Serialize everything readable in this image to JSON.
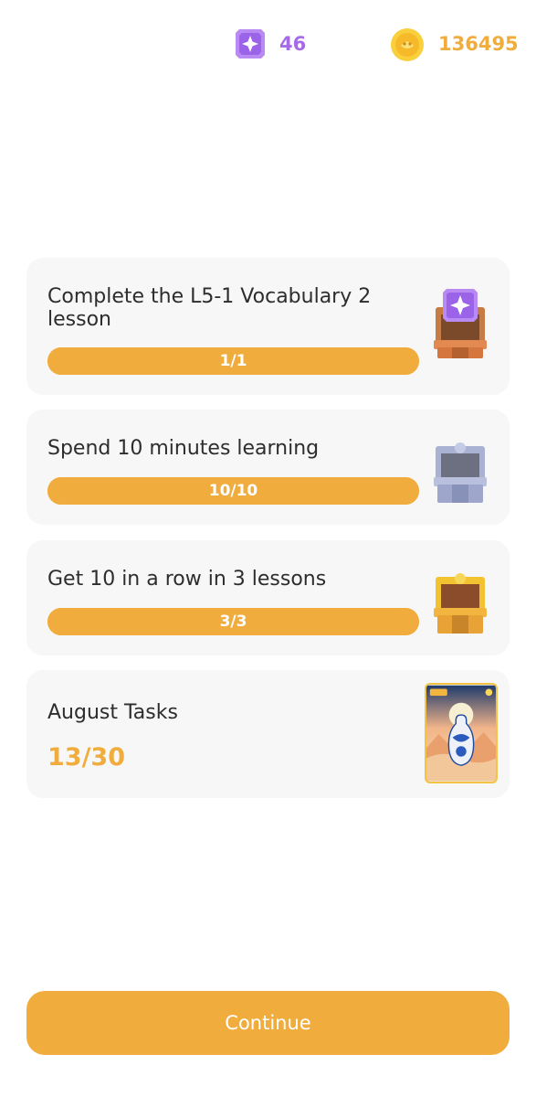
{
  "header": {
    "gem_icon": "purple-gem-icon",
    "gem_count": "46",
    "coin_icon": "gold-coin-icon",
    "coin_count": "136495",
    "gem_color": "#a66be6",
    "coin_color": "#f0ad3e"
  },
  "tasks": [
    {
      "title": "Complete the L5-1 Vocabulary 2 lesson",
      "progress_label": "1/1",
      "progress": 1.0,
      "reward_icon": "purple-gem-chest-icon"
    },
    {
      "title": "Spend 10 minutes learning",
      "progress_label": "10/10",
      "progress": 1.0,
      "reward_icon": "silver-chest-icon"
    },
    {
      "title": "Get 10 in a row in 3 lessons",
      "progress_label": "3/3",
      "progress": 1.0,
      "reward_icon": "gold-chest-icon"
    }
  ],
  "monthly": {
    "title": "August Tasks",
    "progress_label": "13/30",
    "progress": 0.4333,
    "reward_icon": "porcelain-vase-card-icon"
  },
  "footer": {
    "continue_label": "Continue"
  },
  "colors": {
    "accent": "#f0ad3e",
    "card_bg": "#f6f7f6"
  }
}
